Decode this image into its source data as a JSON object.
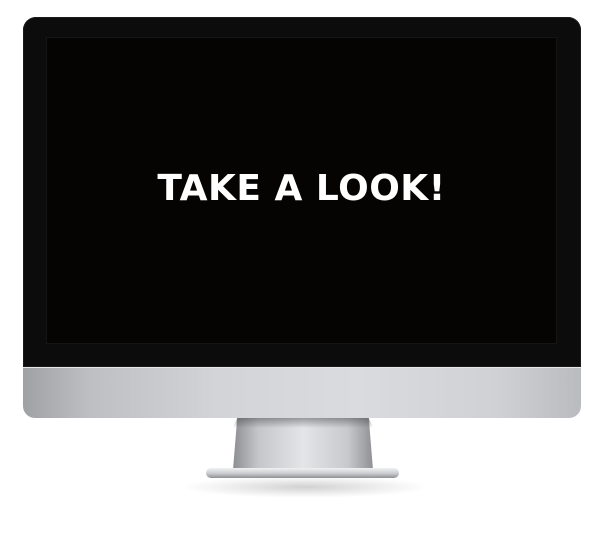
{
  "screen": {
    "headline": "TAKE A LOOK!"
  },
  "device": {
    "type": "desktop-monitor",
    "bezel_color": "#0c0c0c",
    "screen_color": "#050403",
    "chin_color": "#d2d4d7",
    "headline_color": "#ffffff"
  }
}
